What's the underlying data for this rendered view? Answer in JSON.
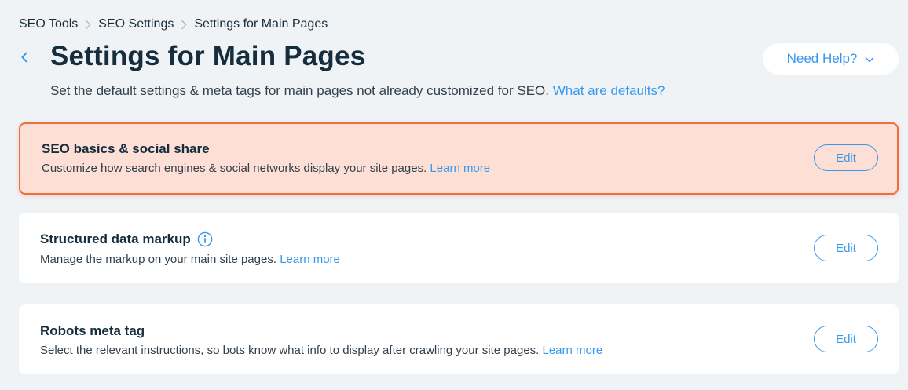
{
  "breadcrumb": {
    "items": [
      "SEO Tools",
      "SEO Settings",
      "Settings for Main Pages"
    ]
  },
  "header": {
    "title": "Settings for Main Pages",
    "subtitle": "Set the default settings & meta tags for main pages not already customized for SEO.",
    "subtitle_link": "What are defaults?",
    "help_label": "Need Help?"
  },
  "cards": [
    {
      "title": "SEO basics & social share",
      "description": "Customize how search engines & social networks display your site pages.",
      "link": "Learn more",
      "edit_label": "Edit",
      "highlighted": true
    },
    {
      "title": "Structured data markup",
      "description": "Manage the markup on your main site pages.",
      "link": "Learn more",
      "edit_label": "Edit",
      "has_info_icon": true
    },
    {
      "title": "Robots meta tag",
      "description": "Select the relevant instructions, so bots know what info to display after crawling your site pages.",
      "link": "Learn more",
      "edit_label": "Edit"
    }
  ],
  "icons": {
    "back": "chevron-left-icon",
    "breadcrumb_separator": "chevron-right-icon",
    "help_dropdown": "chevron-down-icon",
    "info": "info-icon"
  },
  "colors": {
    "accent": "#3899ec",
    "highlight_bg": "#fddfd5",
    "highlight_border": "#ee6e3e",
    "background": "#f0f3f6",
    "text": "#162d3d"
  }
}
